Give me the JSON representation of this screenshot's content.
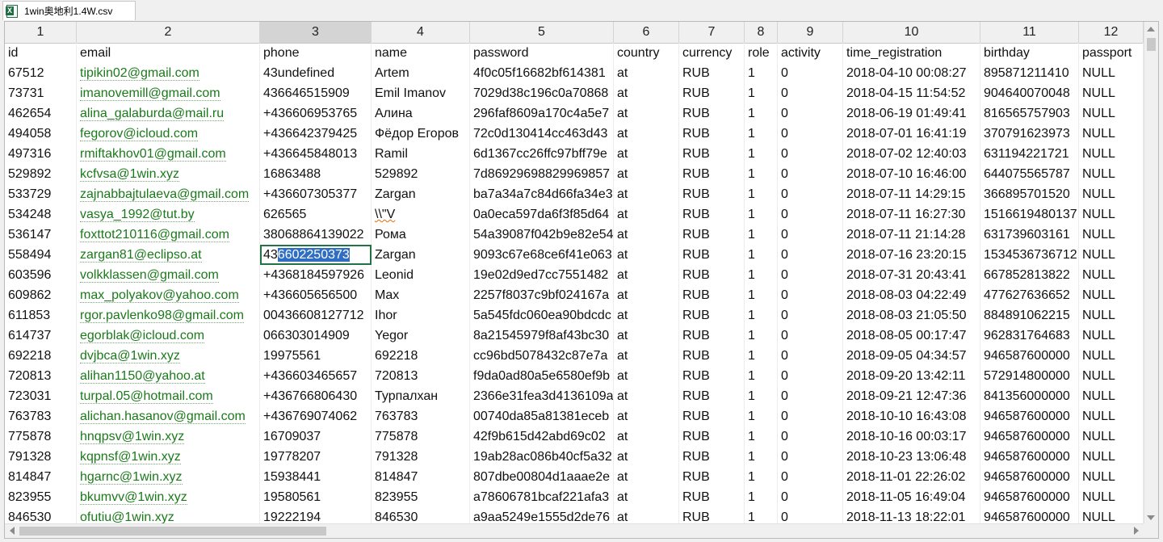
{
  "tab": {
    "filename": "1win奥地利1.4W.csv",
    "icon": "excel-csv-icon"
  },
  "columns": [
    "1",
    "2",
    "3",
    "4",
    "5",
    "6",
    "7",
    "8",
    "9",
    "10",
    "11",
    "12"
  ],
  "selected_column": "3",
  "selection": {
    "row_index": 10,
    "column": "phone",
    "prefix": "43",
    "highlighted": "6602250373"
  },
  "header_row": [
    "id",
    "email",
    "phone",
    "name",
    "password",
    "country",
    "currency",
    "role",
    "activity",
    "time_registration",
    "birthday",
    "passport"
  ],
  "rows": [
    [
      "67512",
      "tipikin02@gmail.com",
      "43undefined",
      "Artem",
      "4f0c05f16682bf614381",
      "at",
      "RUB",
      "1",
      "0",
      "2018-04-10 00:08:27",
      "895871211410",
      "NULL"
    ],
    [
      "73731",
      "imanovemill@gmail.com",
      "436646515909",
      "Emil Imanov",
      "7029d38c196c0a70868",
      "at",
      "RUB",
      "1",
      "0",
      "2018-04-15 11:54:52",
      "904640070048",
      "NULL"
    ],
    [
      "462654",
      "alina_galaburda@mail.ru",
      "+436606953765",
      "Алина",
      "296faf8609a170c4a5e7",
      "at",
      "RUB",
      "1",
      "0",
      "2018-06-19 01:49:41",
      "816565757903",
      "NULL"
    ],
    [
      "494058",
      "fegorov@icloud.com",
      "+436642379425",
      "Фёдор Егоров",
      "72c0d130414cc463d43",
      "at",
      "RUB",
      "1",
      "0",
      "2018-07-01 16:41:19",
      "370791623973",
      "NULL"
    ],
    [
      "497316",
      "rmiftakhov01@gmail.com",
      "+436645848013",
      "Ramil",
      "6d1367cc26ffc97bff79e",
      "at",
      "RUB",
      "1",
      "0",
      "2018-07-02 12:40:03",
      "631194221721",
      "NULL"
    ],
    [
      "529892",
      "kcfvsa@1win.xyz",
      "16863488",
      "529892",
      "7d86929698829969857",
      "at",
      "RUB",
      "1",
      "0",
      "2018-07-10 16:46:00",
      "644075565787",
      "NULL"
    ],
    [
      "533729",
      "zajnabbajtulaeva@gmail.com",
      "+436607305377",
      "Zargan",
      "ba7a34a7c84d66fa34e3",
      "at",
      "RUB",
      "1",
      "0",
      "2018-07-11 14:29:15",
      "366895701520",
      "NULL"
    ],
    [
      "534248",
      "vasya_1992@tut.by",
      "626565",
      "\\\\\"V",
      "0a0eca597da6f3f85d64",
      "at",
      "RUB",
      "1",
      "0",
      "2018-07-11 16:27:30",
      "1516619480137",
      "NULL"
    ],
    [
      "536147",
      "foxttot210116@gmail.com",
      "38068864139022",
      "Рома",
      "54a39087f042b9e82e54",
      "at",
      "RUB",
      "1",
      "0",
      "2018-07-11 21:14:28",
      "631739603161",
      "NULL"
    ],
    [
      "558494",
      "zargan81@eclipso.at",
      "436602250373",
      "Zargan",
      "9093c67e68ce6f41e063",
      "at",
      "RUB",
      "1",
      "0",
      "2018-07-16 23:20:15",
      "1534536736712",
      "NULL"
    ],
    [
      "603596",
      "volkklassen@gmail.com",
      "+4368184597926",
      "Leonid",
      "19e02d9ed7cc7551482",
      "at",
      "RUB",
      "1",
      "0",
      "2018-07-31 20:43:41",
      "667852813822",
      "NULL"
    ],
    [
      "609862",
      "max_polyakov@yahoo.com",
      "+436605656500",
      "Max",
      "2257f8037c9bf024167a",
      "at",
      "RUB",
      "1",
      "0",
      "2018-08-03 04:22:49",
      "477627636652",
      "NULL"
    ],
    [
      "611853",
      "rgor.pavlenko98@gmail.com",
      "00436608127712",
      "Ihor",
      "5a545fdc060ea90bdcdc",
      "at",
      "RUB",
      "1",
      "0",
      "2018-08-03 21:05:50",
      "884891062215",
      "NULL"
    ],
    [
      "614737",
      "egorblak@icloud.com",
      "066303014909",
      "Yegor",
      "8a21545979f8af43bc30",
      "at",
      "RUB",
      "1",
      "0",
      "2018-08-05 00:17:47",
      "962831764683",
      "NULL"
    ],
    [
      "692218",
      "dvjbca@1win.xyz",
      "19975561",
      "692218",
      "cc96bd5078432c87e7a",
      "at",
      "RUB",
      "1",
      "0",
      "2018-09-05 04:34:57",
      "946587600000",
      "NULL"
    ],
    [
      "720813",
      "alihan1150@yahoo.at",
      "+436603465657",
      "720813",
      "f9da0ad80a5e6580ef9b",
      "at",
      "RUB",
      "1",
      "0",
      "2018-09-20 13:42:11",
      "572914800000",
      "NULL"
    ],
    [
      "723031",
      "turpal.05@hotmail.com",
      "+436766806430",
      "Турпалхан",
      "2366e31fea3d4136109a",
      "at",
      "RUB",
      "1",
      "0",
      "2018-09-21 12:47:36",
      "841356000000",
      "NULL"
    ],
    [
      "763783",
      "alichan.hasanov@gmail.com",
      "+436769074062",
      "763783",
      "00740da85a81381eceb",
      "at",
      "RUB",
      "1",
      "0",
      "2018-10-10 16:43:08",
      "946587600000",
      "NULL"
    ],
    [
      "775878",
      "hnqpsv@1win.xyz",
      "16709037",
      "775878",
      "42f9b615d42abd69c02",
      "at",
      "RUB",
      "1",
      "0",
      "2018-10-16 00:03:17",
      "946587600000",
      "NULL"
    ],
    [
      "791328",
      "kqpnsf@1win.xyz",
      "19778207",
      "791328",
      "19ab28ac086b40cf5a32",
      "at",
      "RUB",
      "1",
      "0",
      "2018-10-23 13:06:48",
      "946587600000",
      "NULL"
    ],
    [
      "814847",
      "hgarnc@1win.xyz",
      "15938441",
      "814847",
      "807dbe00804d1aaae2e",
      "at",
      "RUB",
      "1",
      "0",
      "2018-11-01 22:26:02",
      "946587600000",
      "NULL"
    ],
    [
      "823955",
      "bkumvv@1win.xyz",
      "19580561",
      "823955",
      "a78606781bcaf221afa3",
      "at",
      "RUB",
      "1",
      "0",
      "2018-11-05 16:49:04",
      "946587600000",
      "NULL"
    ],
    [
      "846530",
      "ofutiu@1win.xyz",
      "19222194",
      "846530",
      "a9aa5249e1555d2de76",
      "at",
      "RUB",
      "1",
      "0",
      "2018-11-13 18:22:01",
      "946587600000",
      "NULL"
    ]
  ]
}
